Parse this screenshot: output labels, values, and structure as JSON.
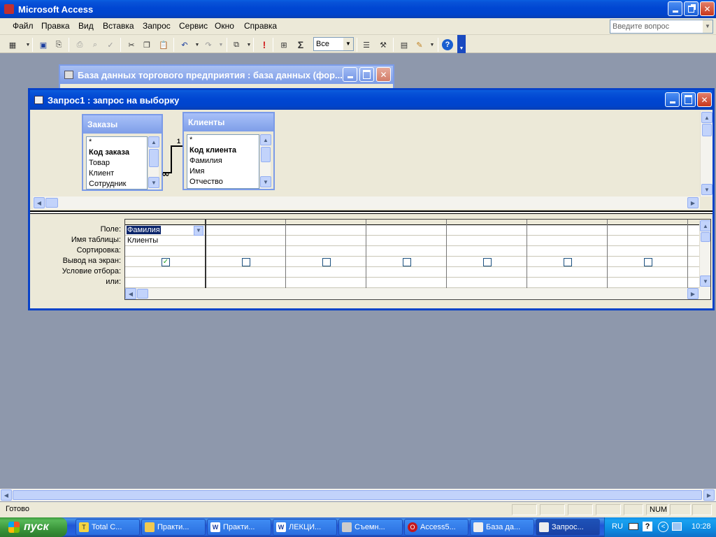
{
  "app": {
    "title": "Microsoft Access"
  },
  "menu": {
    "items": [
      "Файл",
      "Правка",
      "Вид",
      "Вставка",
      "Запрос",
      "Сервис",
      "Окно",
      "Справка"
    ],
    "help_placeholder": "Введите вопрос"
  },
  "toolbar": {
    "top_values": "Все",
    "icons": [
      "view-icon",
      "save-icon",
      "save-as-icon",
      "print-icon",
      "print-preview-icon",
      "spelling-icon",
      "cut-icon",
      "copy-icon",
      "paste-icon",
      "undo-icon",
      "redo-icon",
      "query-type-icon",
      "run-icon",
      "show-table-icon",
      "totals-icon",
      "properties-icon",
      "build-icon",
      "database-window-icon",
      "new-object-icon",
      "help-icon"
    ]
  },
  "db_window": {
    "title": "База данных торгового предприятия : база данных (фор..."
  },
  "query_window": {
    "title": "Запрос1 : запрос на выборку",
    "tables": [
      {
        "name": "Заказы",
        "fields": [
          "*",
          "Код заказа",
          "Товар",
          "Клиент",
          "Сотрудник"
        ],
        "key": "Код заказа"
      },
      {
        "name": "Клиенты",
        "fields": [
          "*",
          "Код клиента",
          "Фамилия",
          "Имя",
          "Отчество"
        ],
        "key": "Код клиента"
      }
    ],
    "relation": {
      "one": "1",
      "many": "∞"
    },
    "grid": {
      "row_labels": [
        "Поле:",
        "Имя таблицы:",
        "Сортировка:",
        "Вывод на экран:",
        "Условие отбора:",
        "или:"
      ],
      "columns": [
        {
          "field": "Фамилия",
          "table": "Клиенты",
          "show": true
        },
        {
          "field": "",
          "table": "",
          "show": false
        },
        {
          "field": "",
          "table": "",
          "show": false
        },
        {
          "field": "",
          "table": "",
          "show": false
        },
        {
          "field": "",
          "table": "",
          "show": false
        },
        {
          "field": "",
          "table": "",
          "show": false
        },
        {
          "field": "",
          "table": "",
          "show": false
        }
      ]
    }
  },
  "status": {
    "text": "Готово",
    "num": "NUM"
  },
  "taskbar": {
    "start": "пуск",
    "tasks": [
      "Total C...",
      "Практи...",
      "Практи...",
      "ЛЕКЦИ...",
      "Съемн...",
      "Access5...",
      "База да...",
      "Запрос..."
    ],
    "lang": "RU",
    "clock": "10:28"
  },
  "colors": {
    "title_blue": "#0046d2",
    "desktop": "#8e98ac",
    "start_green": "#3a953a"
  }
}
